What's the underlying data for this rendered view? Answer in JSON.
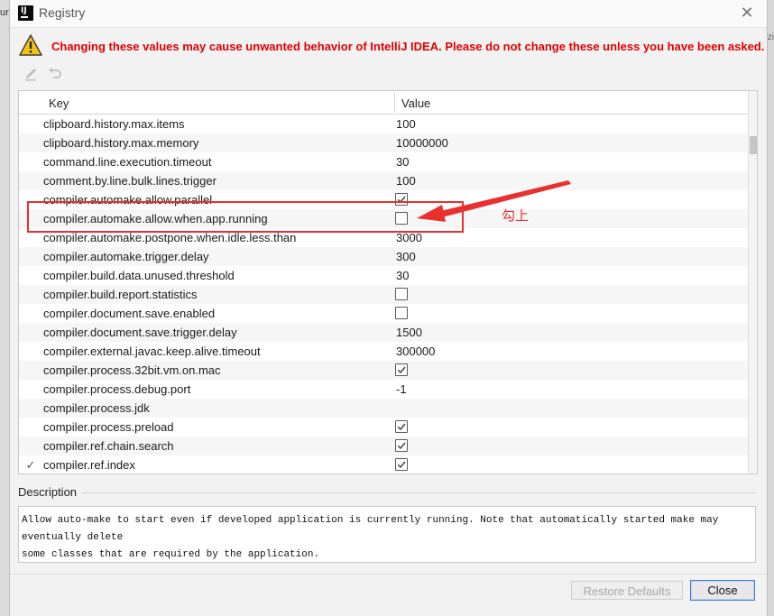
{
  "window": {
    "title": "Registry"
  },
  "background": {
    "left_fragment": "ur",
    "right_fragment": "ka.zi"
  },
  "warning": {
    "text": "Changing these values may cause unwanted behavior of IntelliJ IDEA. Please do not change these unless you have been asked."
  },
  "toolbar": {
    "edit_icon": "pencil-icon",
    "revert_icon": "undo-icon"
  },
  "table": {
    "columns": {
      "key": "Key",
      "value": "Value"
    },
    "rows": [
      {
        "key": "clipboard.history.max.items",
        "value": "100",
        "type": "text",
        "modified": false
      },
      {
        "key": "clipboard.history.max.memory",
        "value": "10000000",
        "type": "text",
        "modified": false
      },
      {
        "key": "command.line.execution.timeout",
        "value": "30",
        "type": "text",
        "modified": false
      },
      {
        "key": "comment.by.line.bulk.lines.trigger",
        "value": "100",
        "type": "text",
        "modified": false
      },
      {
        "key": "compiler.automake.allow.parallel",
        "value": true,
        "type": "bool",
        "modified": false
      },
      {
        "key": "compiler.automake.allow.when.app.running",
        "value": false,
        "type": "bool",
        "modified": false
      },
      {
        "key": "compiler.automake.postpone.when.idle.less.than",
        "value": "3000",
        "type": "text",
        "modified": false
      },
      {
        "key": "compiler.automake.trigger.delay",
        "value": "300",
        "type": "text",
        "modified": false
      },
      {
        "key": "compiler.build.data.unused.threshold",
        "value": "30",
        "type": "text",
        "modified": false
      },
      {
        "key": "compiler.build.report.statistics",
        "value": false,
        "type": "bool",
        "modified": false
      },
      {
        "key": "compiler.document.save.enabled",
        "value": false,
        "type": "bool",
        "modified": false
      },
      {
        "key": "compiler.document.save.trigger.delay",
        "value": "1500",
        "type": "text",
        "modified": false
      },
      {
        "key": "compiler.external.javac.keep.alive.timeout",
        "value": "300000",
        "type": "text",
        "modified": false
      },
      {
        "key": "compiler.process.32bit.vm.on.mac",
        "value": true,
        "type": "bool",
        "modified": false
      },
      {
        "key": "compiler.process.debug.port",
        "value": "-1",
        "type": "text",
        "modified": false
      },
      {
        "key": "compiler.process.jdk",
        "value": "",
        "type": "text",
        "modified": false
      },
      {
        "key": "compiler.process.preload",
        "value": true,
        "type": "bool",
        "modified": false
      },
      {
        "key": "compiler.ref.chain.search",
        "value": true,
        "type": "bool",
        "modified": false
      },
      {
        "key": "compiler.ref.index",
        "value": true,
        "type": "bool",
        "modified": true
      }
    ]
  },
  "annotation": {
    "text": "勾上",
    "color": "#e8302e"
  },
  "description": {
    "label": "Description",
    "text": "Allow auto-make to start even if developed application is currently running. Note that automatically started make may eventually delete\nsome classes that are required by the application."
  },
  "buttons": {
    "restore_defaults": "Restore Defaults",
    "close": "Close"
  },
  "colors": {
    "warning_red": "#e00000",
    "accent_blue": "#3d7dd8"
  }
}
